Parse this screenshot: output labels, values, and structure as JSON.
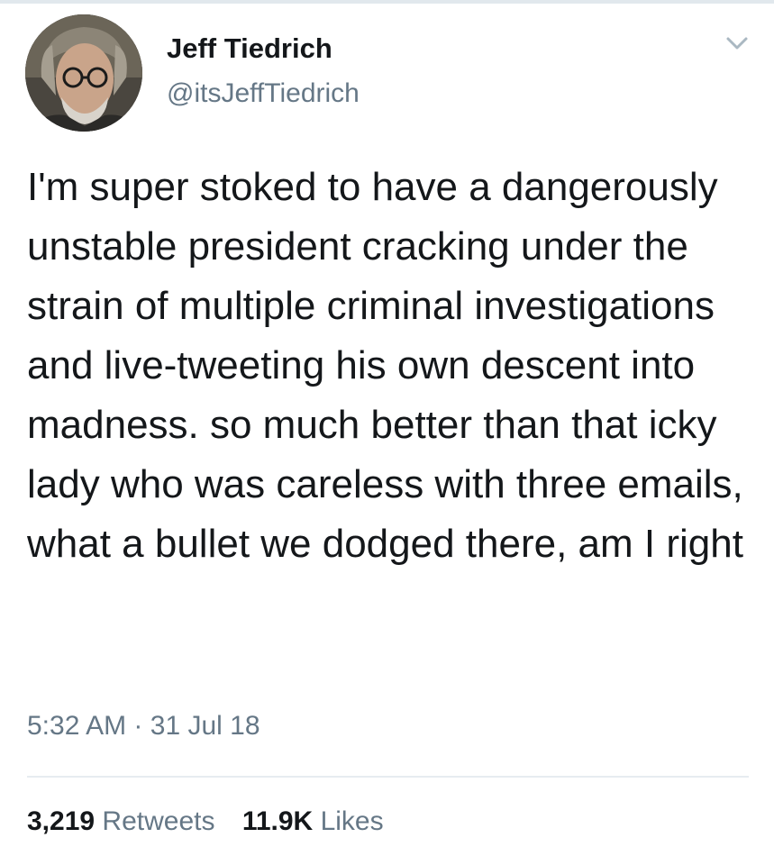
{
  "tweet": {
    "author": {
      "display_name": "Jeff Tiedrich",
      "handle": "@itsJeffTiedrich",
      "avatar_icon": "profile-photo"
    },
    "menu_icon": "chevron-down-icon",
    "text": "I'm super stoked to have a dangerously unstable president cracking under the strain of multiple criminal investigations and live-tweeting his own descent into madness. so much better than that icky lady who was careless with three emails, what a bullet we dodged there, am I right",
    "timestamp": {
      "time": "5:32 AM",
      "separator": "·",
      "date": "31 Jul 18"
    },
    "stats": {
      "retweets_count": "3,219",
      "retweets_label": "Retweets",
      "likes_count": "11.9K",
      "likes_label": "Likes"
    }
  },
  "colors": {
    "text_primary": "#14171a",
    "text_secondary": "#657786",
    "divider": "#e6ecf0"
  }
}
